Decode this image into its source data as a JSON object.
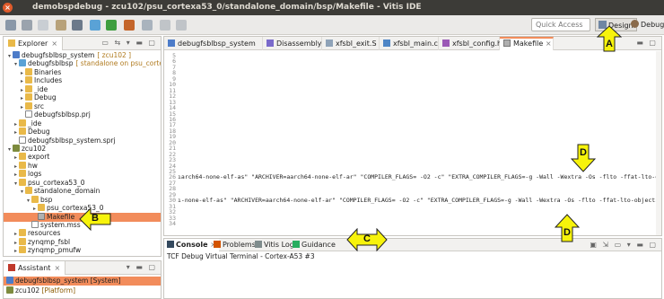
{
  "window": {
    "title": "demobspdebug - zcu102/psu_cortexa53_0/standalone_domain/bsp/Makefile - Vitis IDE",
    "close_glyph": "×"
  },
  "toolbar": {
    "quick_access_placeholder": "Quick Access",
    "perspectives": [
      {
        "label": "Design",
        "icon": "design-perspective-icon"
      },
      {
        "label": "Debug",
        "icon": "debug-perspective-icon"
      }
    ]
  },
  "explorer": {
    "title": "Explorer",
    "tree": [
      {
        "label": "debugfsblbsp_system",
        "suffix": "[ zcu102 ]",
        "icon": "system-project-icon",
        "twisty": "▾",
        "level": 0
      },
      {
        "label": "debugfsblbsp",
        "suffix": "[ standalone on psu_cortexa53_0 ]",
        "icon": "app-project-icon",
        "twisty": "▾",
        "level": 1
      },
      {
        "label": "Binaries",
        "icon": "folder-icon",
        "twisty": "▸",
        "level": 2
      },
      {
        "label": "Includes",
        "icon": "folder-icon",
        "twisty": "▸",
        "level": 2
      },
      {
        "label": "_ide",
        "icon": "folder-icon",
        "twisty": "▸",
        "level": 2
      },
      {
        "label": "Debug",
        "icon": "folder-icon",
        "twisty": "▸",
        "level": 2
      },
      {
        "label": "src",
        "icon": "folder-icon",
        "twisty": "▸",
        "level": 2
      },
      {
        "label": "debugfsblbsp.prj",
        "icon": "file-icon",
        "twisty": "",
        "level": 2
      },
      {
        "label": "_ide",
        "icon": "folder-icon",
        "twisty": "▸",
        "level": 1
      },
      {
        "label": "Debug",
        "icon": "folder-icon",
        "twisty": "▸",
        "level": 1
      },
      {
        "label": "debugfsblbsp_system.sprj",
        "icon": "file-icon",
        "twisty": "",
        "level": 1
      },
      {
        "label": "zcu102",
        "icon": "platform-icon",
        "twisty": "▾",
        "level": 0
      },
      {
        "label": "export",
        "icon": "folder-icon",
        "twisty": "▸",
        "level": 1
      },
      {
        "label": "hw",
        "icon": "folder-icon",
        "twisty": "▸",
        "level": 1
      },
      {
        "label": "logs",
        "icon": "folder-icon",
        "twisty": "▸",
        "level": 1
      },
      {
        "label": "psu_cortexa53_0",
        "icon": "folder-icon",
        "twisty": "▾",
        "level": 1
      },
      {
        "label": "standalone_domain",
        "icon": "folder-icon",
        "twisty": "▾",
        "level": 2
      },
      {
        "label": "bsp",
        "icon": "folder-icon",
        "twisty": "▾",
        "level": 3
      },
      {
        "label": "psu_cortexa53_0",
        "icon": "folder-icon",
        "twisty": "▸",
        "level": 4
      },
      {
        "label": "Makefile",
        "icon": "makefile-icon",
        "twisty": "",
        "level": 4,
        "selected": true
      },
      {
        "label": "system.mss",
        "icon": "file-icon",
        "twisty": "",
        "level": 3
      },
      {
        "label": "resources",
        "icon": "folder-icon",
        "twisty": "▸",
        "level": 1
      },
      {
        "label": "zynqmp_fsbl",
        "icon": "folder-icon",
        "twisty": "▸",
        "level": 1
      },
      {
        "label": "zynqmp_pmufw",
        "icon": "folder-icon",
        "twisty": "▸",
        "level": 1
      }
    ]
  },
  "assistant": {
    "title": "Assistant",
    "items": [
      {
        "label": "debugfsblbsp_system [System]",
        "selected": true
      },
      {
        "label": "zcu102",
        "suffix": "[Platform]",
        "selected": false
      }
    ]
  },
  "editor": {
    "tabs": [
      {
        "label": "debugfsblbsp_system",
        "icon": "system-project-icon",
        "active": false
      },
      {
        "label": "Disassembly",
        "icon": "disassembly-icon",
        "active": false
      },
      {
        "label": "xfsbl_exit.S",
        "icon": "source-file-icon",
        "active": false
      },
      {
        "label": "xfsbl_main.c",
        "icon": "c-file-icon",
        "active": false
      },
      {
        "label": "xfsbl_config.h",
        "icon": "h-file-icon",
        "active": false
      },
      {
        "label": "Makefile",
        "icon": "makefile-icon",
        "active": true,
        "close": "×"
      }
    ],
    "lines": [
      {
        "num": "5",
        "text": ""
      },
      {
        "num": "6",
        "text": ""
      },
      {
        "num": "7",
        "text": ""
      },
      {
        "num": "8",
        "text": ""
      },
      {
        "num": "9",
        "text": ""
      },
      {
        "num": "10",
        "text": ""
      },
      {
        "num": "11",
        "text": ""
      },
      {
        "num": "12",
        "text": ""
      },
      {
        "num": "13",
        "text": ""
      },
      {
        "num": "14",
        "text": ""
      },
      {
        "num": "15",
        "text": ""
      },
      {
        "num": "16",
        "text": ""
      },
      {
        "num": "17",
        "text": ""
      },
      {
        "num": "18",
        "text": ""
      },
      {
        "num": "19",
        "text": ""
      },
      {
        "num": "20",
        "text": ""
      },
      {
        "num": "21",
        "text": ""
      },
      {
        "num": "22",
        "text": ""
      },
      {
        "num": "23",
        "text": ""
      },
      {
        "num": "24",
        "text": ""
      },
      {
        "num": "25",
        "text": ""
      },
      {
        "num": "26",
        "text": "ıarch64-none-elf-as\" \"ARCHIVER=aarch64-none-elf-ar\" \"COMPILER_FLAGS=  -O2 -c\" \"EXTRA_COMPILER_FLAGS=-g -Wall -Wextra -Os -flto -ffat-lto-objects\""
      },
      {
        "num": "27",
        "text": ""
      },
      {
        "num": "28",
        "text": ""
      },
      {
        "num": "29",
        "text": ""
      },
      {
        "num": "30",
        "text": "ı-none-elf-as\" \"ARCHIVER=aarch64-none-elf-ar\" \"COMPILER_FLAGS=  -O2 -c\" \"EXTRA_COMPILER_FLAGS=-g -Wall -Wextra -Os -flto -ffat-lto-objects\""
      },
      {
        "num": "31",
        "text": ""
      },
      {
        "num": "32",
        "text": ""
      },
      {
        "num": "33",
        "text": ""
      },
      {
        "num": "34",
        "text": ""
      }
    ]
  },
  "console": {
    "tabs": [
      {
        "label": "Console",
        "icon": "console-icon",
        "active": true,
        "close": "×"
      },
      {
        "label": "Problems",
        "icon": "problems-icon",
        "active": false
      },
      {
        "label": "Vitis Log",
        "icon": "log-icon",
        "active": false
      },
      {
        "label": "Guidance",
        "icon": "guidance-icon",
        "active": false
      }
    ],
    "title": "TCF Debug Virtual Terminal - Cortex-A53 #3"
  },
  "callouts": [
    {
      "label": "A"
    },
    {
      "label": "B"
    },
    {
      "label": "C"
    },
    {
      "label": "D"
    },
    {
      "label": "D"
    }
  ],
  "colors": {
    "selection": "#f28c5b",
    "callout_fill": "#f7f30b",
    "title_bar": "#3c3b37",
    "close_button": "#e05b2b"
  }
}
